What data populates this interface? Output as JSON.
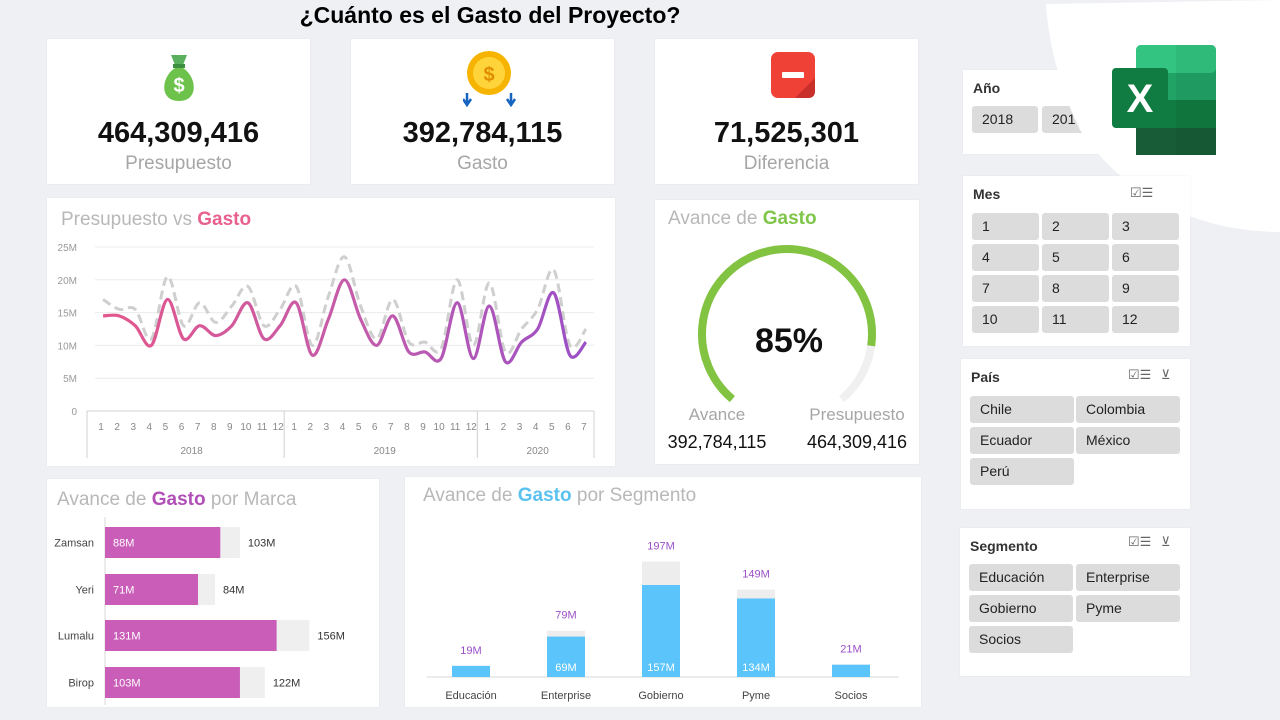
{
  "header": {
    "title": "¿Cuánto es el Gasto del Proyecto?"
  },
  "kpis": [
    {
      "value": "464,309,416",
      "label": "Presupuesto",
      "icon": "money-bag-icon"
    },
    {
      "value": "392,784,115",
      "label": "Gasto",
      "icon": "coin-down-icon"
    },
    {
      "value": "71,525,301",
      "label": "Diferencia",
      "icon": "minus-icon"
    }
  ],
  "line_chart": {
    "title_a": "Presupuesto vs ",
    "title_b": "Gasto",
    "y_ticks": [
      "25M",
      "20M",
      "15M",
      "10M",
      "5M",
      "0"
    ],
    "months": [
      "1",
      "2",
      "3",
      "4",
      "5",
      "6",
      "7",
      "8",
      "9",
      "10",
      "11",
      "12",
      "1",
      "2",
      "3",
      "4",
      "5",
      "6",
      "7",
      "8",
      "9",
      "10",
      "11",
      "12",
      "1",
      "2",
      "3",
      "4",
      "5",
      "6",
      "7"
    ],
    "years": [
      "2018",
      "2019",
      "2020"
    ]
  },
  "gauge": {
    "title_a": "Avance de ",
    "title_b": "Gasto",
    "percent": "85%",
    "fraction": 0.85,
    "left_label": "Avance",
    "left_value": "392,784,115",
    "right_label": "Presupuesto",
    "right_value": "464,309,416"
  },
  "brand": {
    "title_a": "Avance de ",
    "title_b": "Gasto",
    "title_c": " por Marca",
    "rows": [
      {
        "name": "Zamsan",
        "gasto": 88,
        "presupuesto": 103,
        "gasto_label": "88M",
        "presupuesto_label": "103M"
      },
      {
        "name": "Yeri",
        "gasto": 71,
        "presupuesto": 84,
        "gasto_label": "71M",
        "presupuesto_label": "84M"
      },
      {
        "name": "Lumalu",
        "gasto": 131,
        "presupuesto": 156,
        "gasto_label": "131M",
        "presupuesto_label": "156M"
      },
      {
        "name": "Birop",
        "gasto": 103,
        "presupuesto": 122,
        "gasto_label": "103M",
        "presupuesto_label": "122M"
      }
    ]
  },
  "segment": {
    "title_a": "Avance de ",
    "title_b": "Gasto",
    "title_c": " por Segmento",
    "cols": [
      {
        "name": "Educación",
        "gasto": 19,
        "presupuesto": 19,
        "top_label": "19M",
        "inner_label": ""
      },
      {
        "name": "Enterprise",
        "gasto": 69,
        "presupuesto": 79,
        "top_label": "79M",
        "inner_label": "69M"
      },
      {
        "name": "Gobierno",
        "gasto": 157,
        "presupuesto": 197,
        "top_label": "197M",
        "inner_label": "157M"
      },
      {
        "name": "Pyme",
        "gasto": 134,
        "presupuesto": 149,
        "top_label": "149M",
        "inner_label": "134M"
      },
      {
        "name": "Socios",
        "gasto": 21,
        "presupuesto": 21,
        "top_label": "21M",
        "inner_label": ""
      }
    ]
  },
  "slicers": {
    "anio": {
      "title": "Año",
      "items": [
        "2018",
        "2019"
      ]
    },
    "mes": {
      "title": "Mes",
      "items": [
        "1",
        "2",
        "3",
        "4",
        "5",
        "6",
        "7",
        "8",
        "9",
        "10",
        "11",
        "12"
      ]
    },
    "pais": {
      "title": "País",
      "items": [
        "Chile",
        "Colombia",
        "Ecuador",
        "México",
        "Perú"
      ]
    },
    "segmento": {
      "title": "Segmento",
      "items": [
        "Educación",
        "Enterprise",
        "Gobierno",
        "Pyme",
        "Socios"
      ]
    }
  },
  "logo": {
    "icon": "excel-logo-icon",
    "letter": "X"
  },
  "chart_data": [
    {
      "type": "line",
      "title": "Presupuesto vs Gasto",
      "x": [
        "2018-01",
        "2018-02",
        "2018-03",
        "2018-04",
        "2018-05",
        "2018-06",
        "2018-07",
        "2018-08",
        "2018-09",
        "2018-10",
        "2018-11",
        "2018-12",
        "2019-01",
        "2019-02",
        "2019-03",
        "2019-04",
        "2019-05",
        "2019-06",
        "2019-07",
        "2019-08",
        "2019-09",
        "2019-10",
        "2019-11",
        "2019-12",
        "2020-01",
        "2020-02",
        "2020-03",
        "2020-04",
        "2020-05",
        "2020-06",
        "2020-07"
      ],
      "ylim": [
        0,
        25
      ],
      "series": [
        {
          "name": "Presupuesto",
          "values": [
            17,
            15.5,
            15.5,
            11,
            20.5,
            13,
            16.5,
            13.5,
            16,
            19,
            13,
            15.5,
            19,
            10,
            17.5,
            23.5,
            16,
            11,
            17,
            10.5,
            10.5,
            9.5,
            20,
            10,
            19.5,
            9,
            12.5,
            15.5,
            21.5,
            10,
            12.5
          ]
        },
        {
          "name": "Gasto",
          "values": [
            14.5,
            14.5,
            13,
            10,
            17,
            11,
            13,
            11.5,
            13,
            16.5,
            11,
            13,
            16.5,
            8.5,
            14,
            20,
            14,
            10,
            14.5,
            9,
            9,
            8,
            16.5,
            8,
            16,
            7.5,
            10.5,
            12.5,
            18,
            8.5,
            10.5
          ]
        }
      ]
    },
    {
      "type": "bar",
      "title": "Avance de Gasto por Marca",
      "categories": [
        "Zamsan",
        "Yeri",
        "Lumalu",
        "Birop"
      ],
      "series": [
        {
          "values": [
            88,
            71,
            131,
            103
          ]
        },
        {
          "values": [
            103,
            84,
            156,
            122
          ]
        }
      ]
    },
    {
      "type": "bar",
      "title": "Avance de Gasto por Segmento",
      "categories": [
        "Educación",
        "Enterprise",
        "Gobierno",
        "Pyme",
        "Socios"
      ],
      "series": [
        {
          "values": [
            19,
            69,
            157,
            134,
            21
          ]
        },
        {
          "values": [
            19,
            79,
            197,
            149,
            21
          ]
        }
      ]
    }
  ]
}
